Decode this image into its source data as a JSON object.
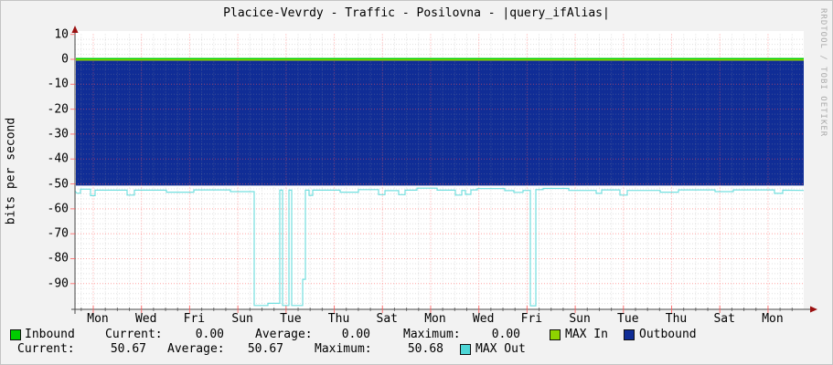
{
  "window": {
    "watermark": "RRDTOOL / TOBI OETIKER"
  },
  "colors": {
    "inbound": "#00CC00",
    "max_in": "#8FD300",
    "outbound": "#102D96",
    "max_out_swatch": "#4DD6D6",
    "max_out_line": "#74E0E0",
    "grid_major": "#FF5A5A",
    "grid_minor": "#999999",
    "axis": "#4A4A4A",
    "arrow": "#9B1010",
    "plot_bg": "#FFFFFF",
    "background": "#F2F2F2"
  },
  "chart_data": {
    "type": "area+line",
    "title": "Placice-Vevrdy - Traffic - Posilovna - |query_ifAlias|",
    "xlabel": "",
    "ylabel": "bits per second",
    "ylim": [
      -100,
      10
    ],
    "grid": "on",
    "legend_position": "bottom",
    "y_ticks": [
      10,
      0,
      -10,
      -20,
      -30,
      -40,
      -50,
      -60,
      -70,
      -80,
      -90
    ],
    "x_ticks": [
      "Mon",
      "Wed",
      "Fri",
      "Sun",
      "Tue",
      "Thu",
      "Sat",
      "Mon",
      "Wed",
      "Fri",
      "Sun",
      "Tue",
      "Thu",
      "Sat",
      "Mon"
    ],
    "series": [
      {
        "name": "Outbound",
        "render": "area",
        "constant": -50.67
      },
      {
        "name": "Inbound",
        "render": "line",
        "constant": 0
      },
      {
        "name": "MAX In",
        "render": "line",
        "constant": 0
      },
      {
        "name": "MAX Out",
        "render": "line",
        "points": [
          [
            0,
            -52.8
          ],
          [
            2,
            -53.7
          ],
          [
            6,
            -53.7
          ],
          [
            6,
            -52.1
          ],
          [
            17,
            -52.1
          ],
          [
            17,
            -54.7
          ],
          [
            22,
            -54.7
          ],
          [
            22,
            -52.5
          ],
          [
            57,
            -52.5
          ],
          [
            57,
            -54.5
          ],
          [
            65,
            -54.5
          ],
          [
            65,
            -52.5
          ],
          [
            100,
            -52.5
          ],
          [
            100,
            -53.3
          ],
          [
            130,
            -53.3
          ],
          [
            130,
            -52.4
          ],
          [
            170,
            -52.4
          ],
          [
            170,
            -53.1
          ],
          [
            196,
            -53.1
          ],
          [
            196,
            -98.8
          ],
          [
            211,
            -98.8
          ],
          [
            211,
            -97.9
          ],
          [
            224,
            -97.9
          ],
          [
            224,
            -52.5
          ],
          [
            227,
            -52.5
          ],
          [
            227,
            -98.8
          ],
          [
            234,
            -98.8
          ],
          [
            234,
            -52.5
          ],
          [
            237,
            -52.5
          ],
          [
            237,
            -98.8
          ],
          [
            249,
            -98.8
          ],
          [
            249,
            -88.3
          ],
          [
            252,
            -88.3
          ],
          [
            252,
            -52.5
          ],
          [
            256,
            -52.5
          ],
          [
            256,
            -54.6
          ],
          [
            260,
            -54.6
          ],
          [
            260,
            -52.5
          ],
          [
            290,
            -52.5
          ],
          [
            290,
            -53.3
          ],
          [
            310,
            -53.3
          ],
          [
            310,
            -52.3
          ],
          [
            332,
            -52.3
          ],
          [
            332,
            -54.3
          ],
          [
            339,
            -54.3
          ],
          [
            339,
            -52.7
          ],
          [
            354,
            -52.7
          ],
          [
            354,
            -54.3
          ],
          [
            361,
            -54.3
          ],
          [
            361,
            -52.5
          ],
          [
            374,
            -52.5
          ],
          [
            374,
            -51.7
          ],
          [
            396,
            -51.7
          ],
          [
            396,
            -52.5
          ],
          [
            416,
            -52.5
          ],
          [
            416,
            -54.5
          ],
          [
            423,
            -54.5
          ],
          [
            423,
            -52.6
          ],
          [
            427,
            -52.6
          ],
          [
            427,
            -54.2
          ],
          [
            433,
            -54.2
          ],
          [
            433,
            -52.4
          ],
          [
            440,
            -52.4
          ],
          [
            440,
            -51.9
          ],
          [
            470,
            -51.9
          ],
          [
            470,
            -52.7
          ],
          [
            480,
            -52.7
          ],
          [
            480,
            -53.4
          ],
          [
            490,
            -53.4
          ],
          [
            490,
            -52.6
          ],
          [
            498,
            -52.6
          ],
          [
            498,
            -98.9
          ],
          [
            504,
            -98.9
          ],
          [
            504,
            -52.3
          ],
          [
            512,
            -52.3
          ],
          [
            512,
            -51.8
          ],
          [
            540,
            -51.8
          ],
          [
            540,
            -52.6
          ],
          [
            570,
            -52.6
          ],
          [
            570,
            -53.8
          ],
          [
            576,
            -53.8
          ],
          [
            576,
            -52.4
          ],
          [
            596,
            -52.4
          ],
          [
            596,
            -54.5
          ],
          [
            604,
            -54.5
          ],
          [
            604,
            -52.6
          ],
          [
            640,
            -52.6
          ],
          [
            640,
            -53.3
          ],
          [
            660,
            -53.3
          ],
          [
            660,
            -52.4
          ],
          [
            700,
            -52.4
          ],
          [
            700,
            -53.1
          ],
          [
            720,
            -53.1
          ],
          [
            720,
            -52.4
          ],
          [
            765,
            -52.4
          ],
          [
            765,
            -53.8
          ],
          [
            774,
            -53.8
          ],
          [
            774,
            -52.5
          ],
          [
            797,
            -52.6
          ]
        ]
      }
    ]
  },
  "legend": {
    "row1": {
      "series_label": "Inbound",
      "current_label": "Current:",
      "current_value": "0.00",
      "average_label": "Average:",
      "average_value": "0.00",
      "maximum_label": "Maximum:",
      "maximum_value": "0.00",
      "max_in_label": "MAX In",
      "outbound_label": "Outbound"
    },
    "row2": {
      "current_label": "Current:",
      "current_value": "50.67",
      "average_label": "Average:",
      "average_value": "50.67",
      "maximum_label": "Maximum:",
      "maximum_value": "50.68",
      "max_out_label": "MAX Out"
    }
  }
}
